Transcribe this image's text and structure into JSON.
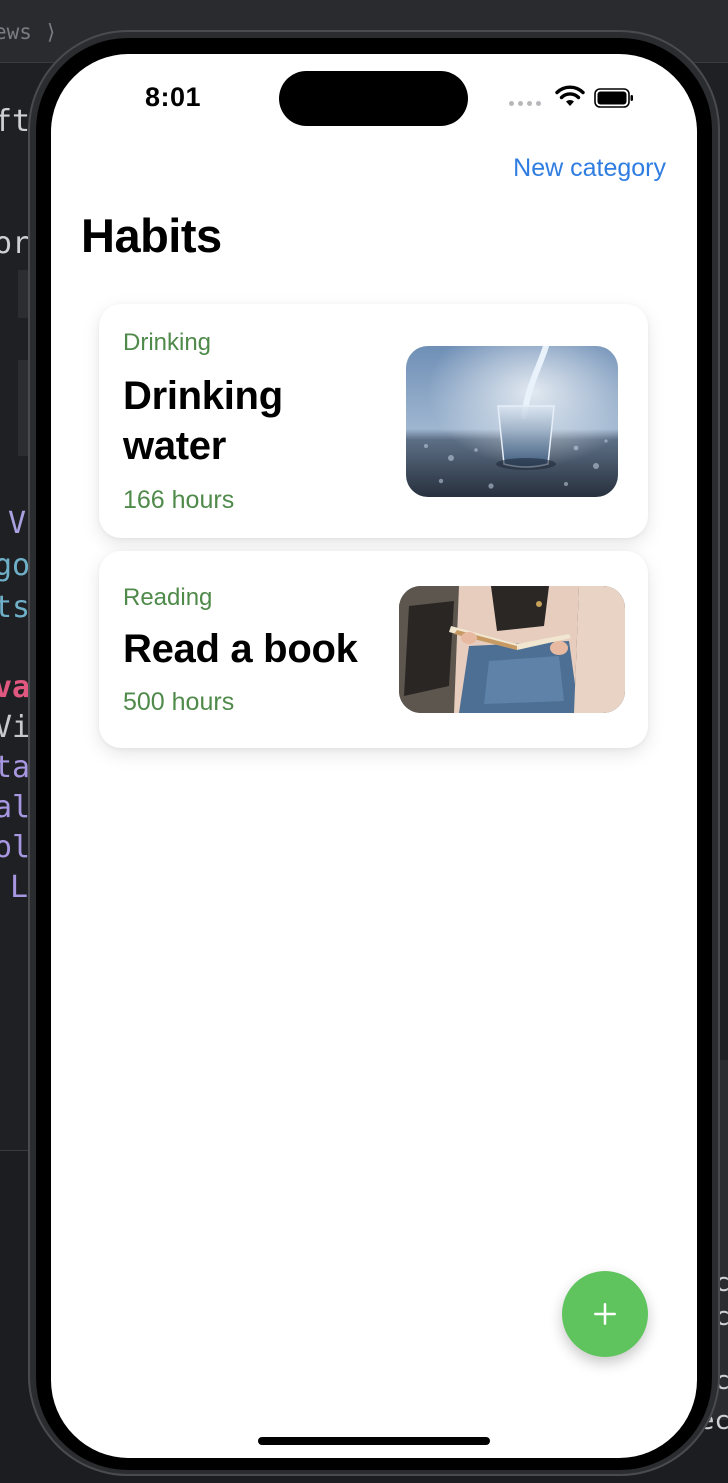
{
  "ide": {
    "crumb": "ews ⟩",
    "code_lines": [
      "ft",
      "or",
      "V",
      "go",
      "ts",
      "va",
      "Vi",
      "ta",
      "al",
      "ol",
      "L"
    ],
    "right_chars": [
      "c",
      "c",
      "c",
      "ec"
    ]
  },
  "status_bar": {
    "time": "8:01"
  },
  "nav": {
    "action_label": "New category",
    "title": "Habits"
  },
  "habits": [
    {
      "category": "Drinking",
      "title": "Drinking water",
      "hours": "166 hours",
      "image": "glass-of-water-photo"
    },
    {
      "category": "Reading",
      "title": "Read a book",
      "hours": "500 hours",
      "image": "person-reading-book-photo"
    }
  ],
  "fab": {
    "icon": "plus-icon",
    "color": "#5fc45e"
  },
  "colors": {
    "accent": "#2f7de1",
    "category_text": "#4f8a4a"
  }
}
